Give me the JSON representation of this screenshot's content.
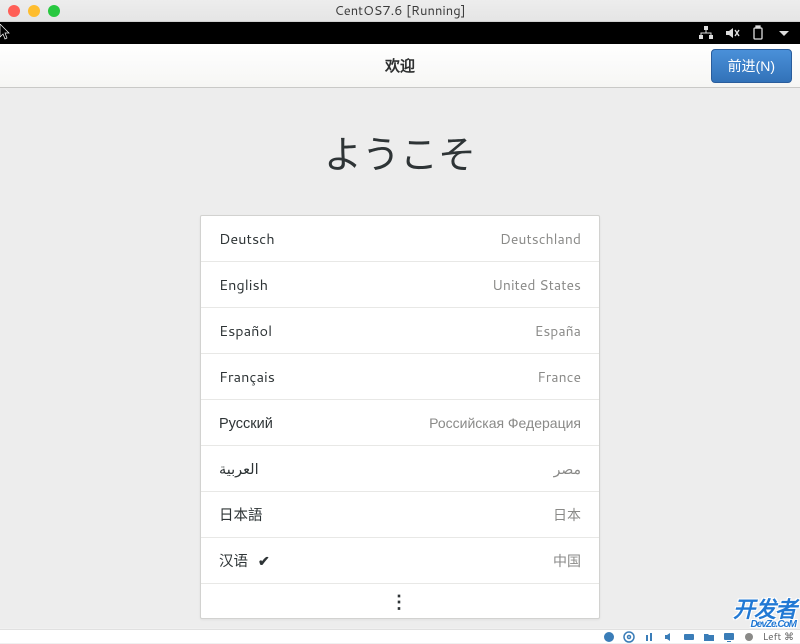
{
  "window": {
    "title": "CentOS7.6 [Running]"
  },
  "gnome_header": {
    "title": "欢迎",
    "next_label": "前进(N)"
  },
  "welcome_heading": "ようこそ",
  "languages": [
    {
      "name": "Deutsch",
      "region": "Deutschland",
      "selected": false
    },
    {
      "name": "English",
      "region": "United States",
      "selected": false
    },
    {
      "name": "Español",
      "region": "España",
      "selected": false
    },
    {
      "name": "Français",
      "region": "France",
      "selected": false
    },
    {
      "name": "Русский",
      "region": "Российская Федерация",
      "selected": false
    },
    {
      "name": "العربية",
      "region": "مصر",
      "selected": false
    },
    {
      "name": "日本語",
      "region": "日本",
      "selected": false
    },
    {
      "name": "汉语",
      "region": "中国",
      "selected": true
    }
  ],
  "more_indicator": "⋮",
  "check_glyph": "✔",
  "vm_bottom": {
    "text_right": "Left ⌘"
  },
  "watermark": {
    "main": "开发者",
    "sub": "DevZe.CoM"
  }
}
